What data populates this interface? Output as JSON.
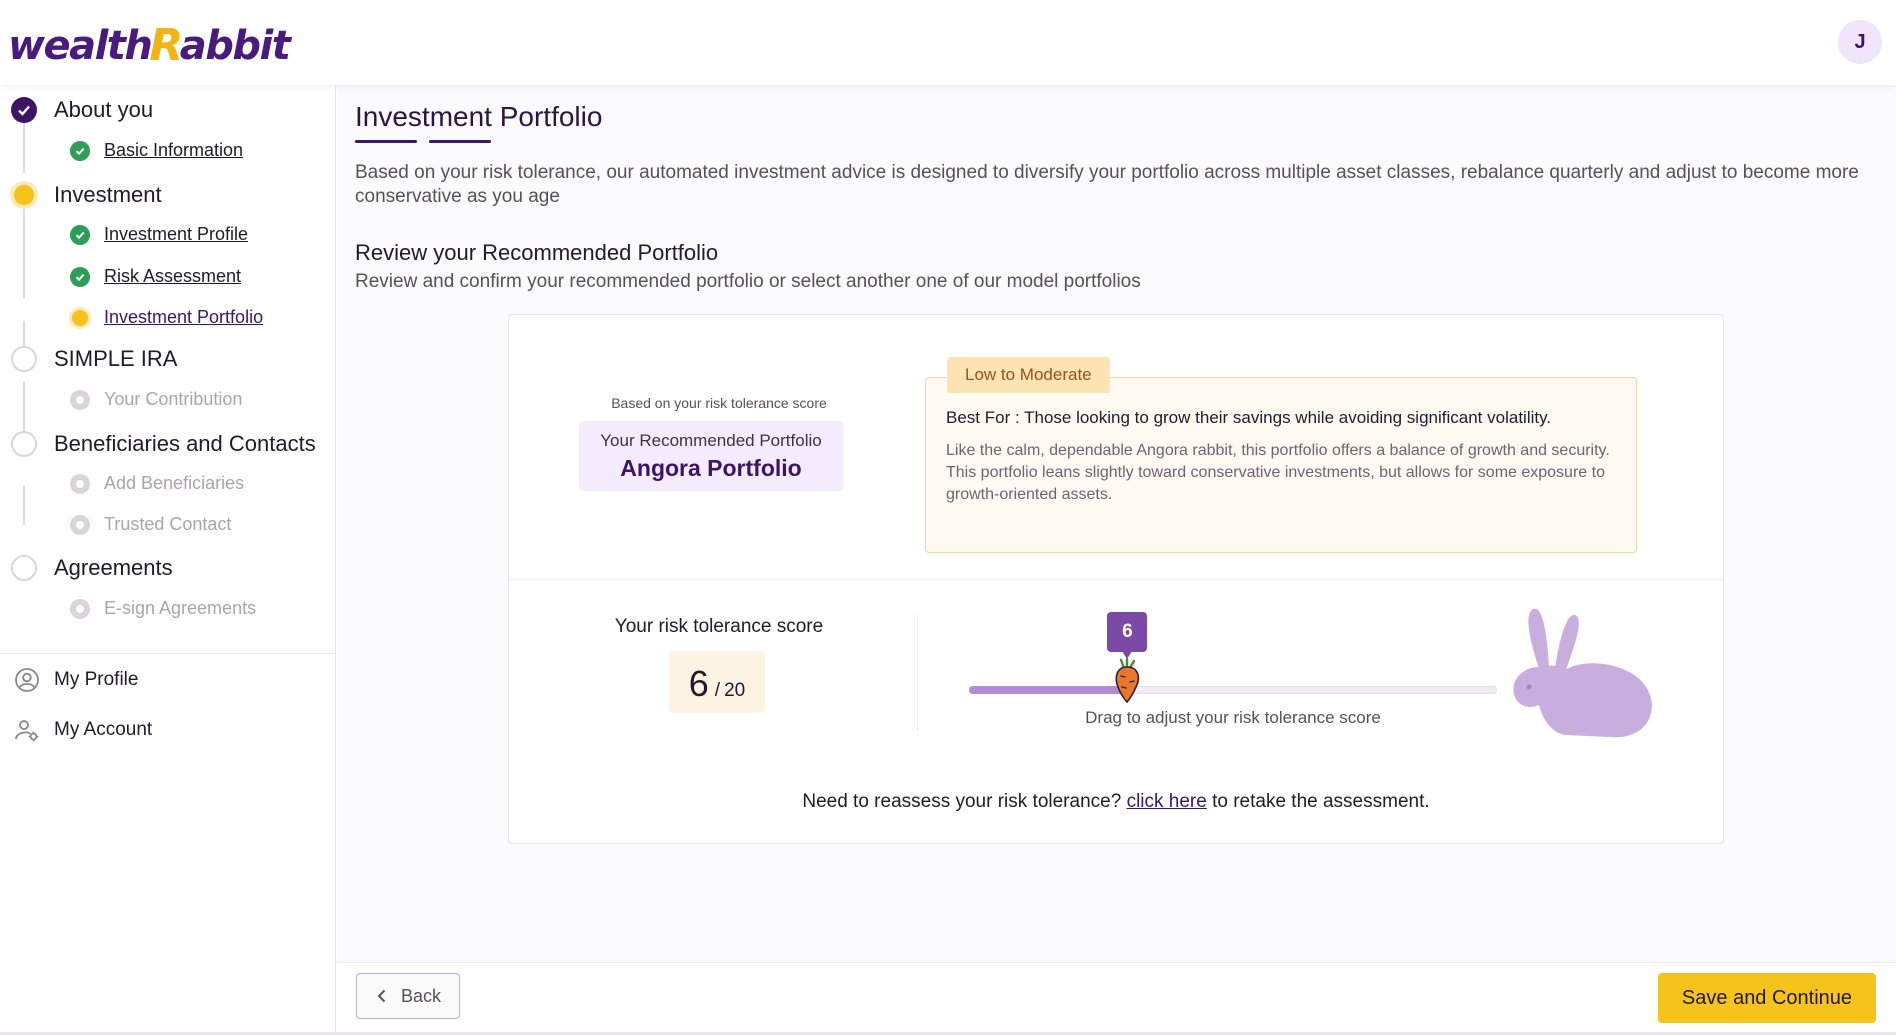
{
  "app": {
    "logo_part1": "wealth",
    "logo_accent": "R",
    "logo_part2": "abbit",
    "user_initial": "J"
  },
  "sidebar": {
    "steps": [
      {
        "label": "About you",
        "state": "done",
        "subs": [
          {
            "label": "Basic Information",
            "state": "done"
          }
        ]
      },
      {
        "label": "Investment",
        "state": "active",
        "subs": [
          {
            "label": "Investment Profile",
            "state": "done"
          },
          {
            "label": "Risk Assessment",
            "state": "done"
          },
          {
            "label": "Investment Portfolio",
            "state": "active"
          }
        ]
      },
      {
        "label": "SIMPLE IRA",
        "state": "pending",
        "subs": [
          {
            "label": "Your Contribution",
            "state": "pending"
          }
        ]
      },
      {
        "label": "Beneficiaries and Contacts",
        "state": "pending",
        "subs": [
          {
            "label": "Add Beneficiaries",
            "state": "pending"
          },
          {
            "label": "Trusted Contact",
            "state": "pending"
          }
        ]
      },
      {
        "label": "Agreements",
        "state": "pending",
        "subs": [
          {
            "label": "E-sign Agreements",
            "state": "pending"
          }
        ]
      }
    ],
    "links": {
      "profile": "My Profile",
      "account": "My Account"
    }
  },
  "main": {
    "title": "Investment Portfolio",
    "description": "Based on your risk tolerance, our automated investment advice is designed to diversify your portfolio across multiple asset classes, rebalance quarterly and adjust to become more conservative as you age",
    "section_title": "Review your Recommended Portfolio",
    "section_desc": "Review and confirm your recommended portfolio or select another one of our model portfolios",
    "recommendation": {
      "caption": "Based on your risk tolerance score",
      "label": "Your Recommended Portfolio",
      "name": "Angora Portfolio"
    },
    "portfolio_info": {
      "badge": "Low to Moderate",
      "best_for": "Best For : Those looking to grow their savings while avoiding significant volatility.",
      "description": "Like the calm, dependable Angora rabbit, this portfolio offers a balance of growth and security. This portfolio leans slightly toward conservative investments, but allows for some exposure to growth-oriented assets."
    },
    "score": {
      "label": "Your risk tolerance score",
      "value": "6",
      "separator": "/",
      "max": "20",
      "slider_value": 6,
      "slider_min": 0,
      "slider_max": 20,
      "slider_caption": "Drag to adjust your risk tolerance score"
    },
    "reassess": {
      "prefix": "Need to reassess your risk tolerance?",
      "link": "click here",
      "suffix": "to retake the assessment."
    }
  },
  "footer": {
    "back": "Back",
    "save": "Save and Continue"
  },
  "colors": {
    "brand": "#3d1467",
    "accent": "#f6c31b",
    "success": "#2e9d55",
    "slider": "#b08cd6"
  }
}
